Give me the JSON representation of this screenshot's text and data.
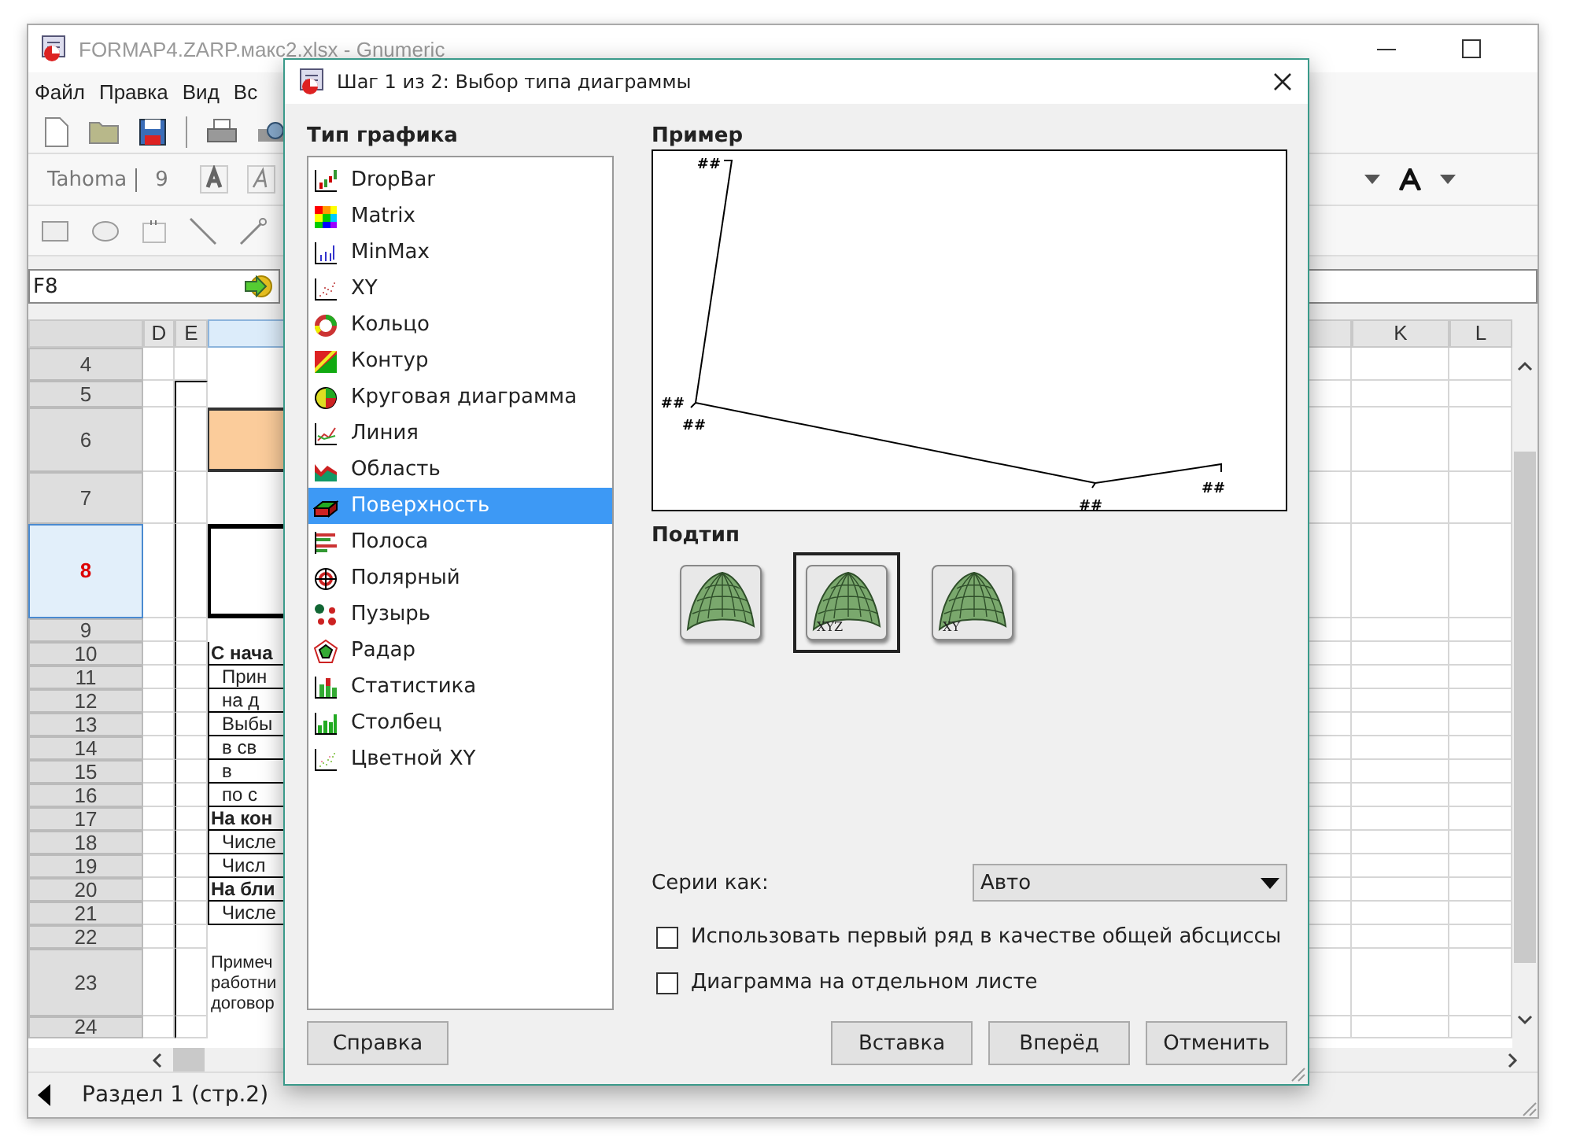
{
  "window": {
    "title": "FORMAP4.ZARP.макс2.xlsx - Gnumeric"
  },
  "menu": [
    "Файл",
    "Правка",
    "Вид",
    "Вс"
  ],
  "format_toolbar": {
    "font": "Tahoma",
    "size": "9"
  },
  "formula_bar": {
    "cell_ref": "F8"
  },
  "columns": [
    {
      "label": "D",
      "selected": false
    },
    {
      "label": "E",
      "selected": false
    },
    {
      "selected": true
    },
    {
      "selected": false
    },
    {
      "label": "K",
      "selected": false
    },
    {
      "label": "L",
      "selected": false
    }
  ],
  "rows": [
    {
      "label": "4",
      "selected": false
    },
    {
      "label": "5",
      "selected": false
    },
    {
      "label": "6",
      "selected": false,
      "kind": "shaded"
    },
    {
      "label": "7",
      "selected": false
    },
    {
      "label": "8",
      "selected": true,
      "kind": "frame"
    },
    {
      "label": "9",
      "selected": false
    },
    {
      "label": "10",
      "selected": false,
      "kind": "bold",
      "text": "С нача"
    },
    {
      "label": "11",
      "selected": false,
      "kind": "plain",
      "text": "Прин"
    },
    {
      "label": "12",
      "selected": false,
      "kind": "plain",
      "text": "на д"
    },
    {
      "label": "13",
      "selected": false,
      "kind": "plain",
      "text": "Выбы"
    },
    {
      "label": "14",
      "selected": false,
      "kind": "plain",
      "text": "в св"
    },
    {
      "label": "15",
      "selected": false,
      "kind": "plain",
      "text": "в"
    },
    {
      "label": "16",
      "selected": false,
      "kind": "plain",
      "text": "по с"
    },
    {
      "label": "17",
      "selected": false,
      "kind": "bold",
      "text": "На кон"
    },
    {
      "label": "18",
      "selected": false,
      "kind": "plain",
      "text": "Числе"
    },
    {
      "label": "19",
      "selected": false,
      "kind": "plain",
      "text": "Числ"
    },
    {
      "label": "20",
      "selected": false,
      "kind": "bold",
      "text": "На бли"
    },
    {
      "label": "21",
      "selected": false,
      "kind": "plain",
      "text": "Числе"
    },
    {
      "label": "22",
      "selected": false
    },
    {
      "label": "23",
      "selected": false,
      "kind": "note",
      "text": "Примеч\nработни\nдоговор"
    },
    {
      "label": "24",
      "selected": false
    }
  ],
  "status_bar": {
    "sheet": "Раздел 1 (стр.2)"
  },
  "dialog": {
    "title": "Шаг 1 из 2: Выбор типа диаграммы",
    "type_heading": "Тип графика",
    "types": [
      {
        "label": "DropBar",
        "selected": false
      },
      {
        "label": "Matrix",
        "selected": false
      },
      {
        "label": "MinMax",
        "selected": false
      },
      {
        "label": "XY",
        "selected": false
      },
      {
        "label": "Кольцо",
        "selected": false
      },
      {
        "label": "Контур",
        "selected": false
      },
      {
        "label": "Круговая диаграмма",
        "selected": false
      },
      {
        "label": "Линия",
        "selected": false
      },
      {
        "label": "Область",
        "selected": false
      },
      {
        "label": "Поверхность",
        "selected": true
      },
      {
        "label": "Полоса",
        "selected": false
      },
      {
        "label": "Полярный",
        "selected": false
      },
      {
        "label": "Пузырь",
        "selected": false
      },
      {
        "label": "Радар",
        "selected": false
      },
      {
        "label": "Статистика",
        "selected": false
      },
      {
        "label": "Столбец",
        "selected": false
      },
      {
        "label": "Цветной XY",
        "selected": false
      }
    ],
    "preview_heading": "Пример",
    "preview_labels": [
      "##",
      "##",
      "##",
      "##",
      "##"
    ],
    "subtype_heading": "Подтип",
    "subtypes": [
      {
        "selected": false
      },
      {
        "label": "XYZ",
        "selected": true
      },
      {
        "label": "XY",
        "selected": false
      }
    ],
    "series_label": "Серии как:",
    "series_value": "Авто",
    "checkboxes": [
      {
        "label": "Использовать первый ряд в качестве общей абсциссы",
        "checked": false
      },
      {
        "label": "Диаграмма на отдельном листе",
        "checked": false
      }
    ],
    "help_button": "Справка",
    "buttons": [
      "Вставка",
      "Вперёд",
      "Отменить"
    ]
  }
}
